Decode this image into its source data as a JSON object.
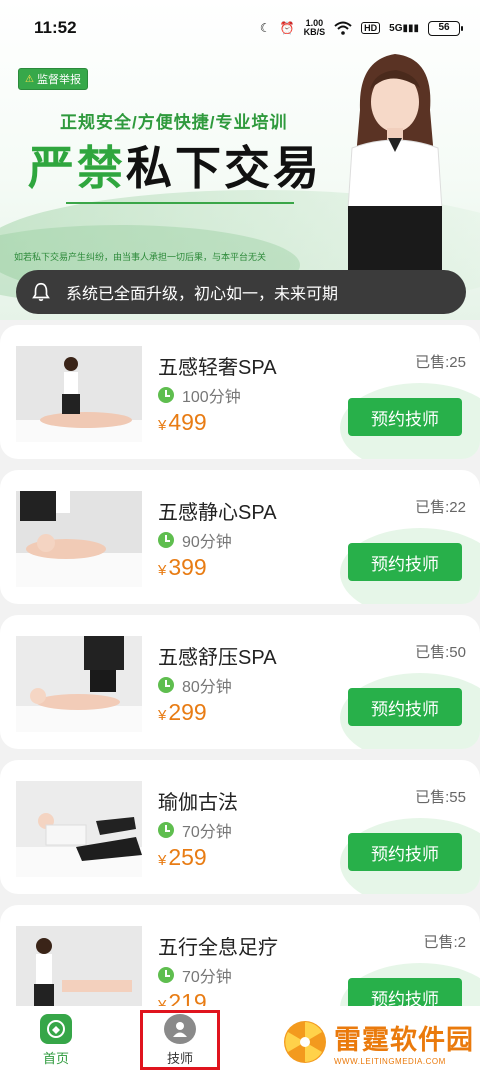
{
  "status_bar": {
    "time": "11:52",
    "net_speed_value": "1.00",
    "net_speed_unit": "KB/S",
    "hd_label": "HD",
    "signal_label": "5G",
    "battery_level": "56"
  },
  "banner": {
    "report_label": "监督举报",
    "subtitle": "正规安全/方便快捷/专业培训",
    "title_highlight": "严禁",
    "title_rest": "私下交易",
    "note": "如若私下交易产生纠纷，由当事人承担一切后果，与本平台无关"
  },
  "notice": {
    "text": "系统已全面升级，初心如一，未来可期"
  },
  "services": [
    {
      "name": "五感轻奢SPA",
      "duration": "100分钟",
      "currency": "¥",
      "price": "499",
      "sold": "已售:25",
      "button": "预约技师"
    },
    {
      "name": "五感静心SPA",
      "duration": "90分钟",
      "currency": "¥",
      "price": "399",
      "sold": "已售:22",
      "button": "预约技师"
    },
    {
      "name": "五感舒压SPA",
      "duration": "80分钟",
      "currency": "¥",
      "price": "299",
      "sold": "已售:50",
      "button": "预约技师"
    },
    {
      "name": "瑜伽古法",
      "duration": "70分钟",
      "currency": "¥",
      "price": "259",
      "sold": "已售:55",
      "button": "预约技师"
    },
    {
      "name": "五行全息足疗",
      "duration": "70分钟",
      "currency": "¥",
      "price": "219",
      "sold": "已售:2",
      "button": "预约技师"
    }
  ],
  "bottom_nav": {
    "home_label": "首页",
    "tech_label": "技师"
  },
  "watermark": {
    "title": "雷霆软件园",
    "subtitle": "WWW.LEITINGMEDIA.COM"
  },
  "colors": {
    "brand_green": "#28b04a",
    "price_orange": "#e87c14",
    "highlight_red": "#e0141e"
  }
}
